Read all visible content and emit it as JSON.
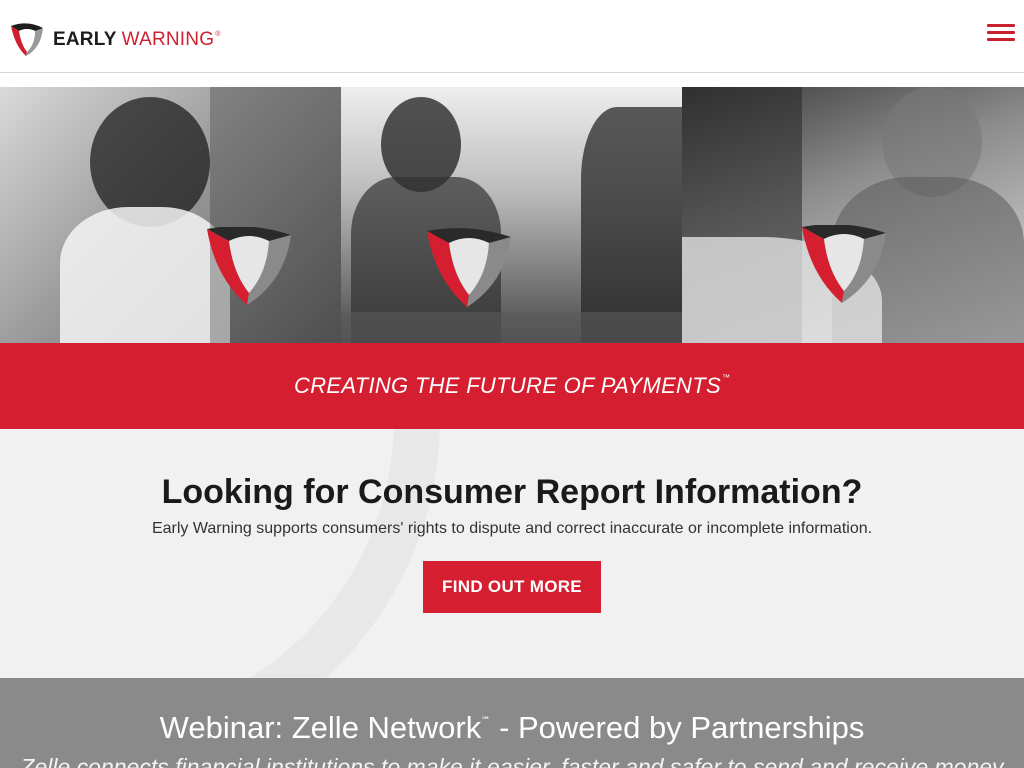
{
  "header": {
    "logo": {
      "early": "EARLY",
      "warning": "WARNING",
      "reg": "®"
    },
    "menu_icon": "hamburger-icon"
  },
  "hero": {
    "panels": [
      {
        "name": "woman-with-phone-photo"
      },
      {
        "name": "handshake-photo"
      },
      {
        "name": "card-payment-photo"
      }
    ],
    "brand_color": "#d51f30"
  },
  "banner": {
    "text": "CREATING THE FUTURE OF PAYMENTS",
    "tm": "™"
  },
  "consumer": {
    "title": "Looking for Consumer Report Information?",
    "text": "Early Warning supports consumers' rights to dispute and correct inaccurate or incomplete information.",
    "button": "FIND OUT MORE"
  },
  "webinar": {
    "title_prefix": "Webinar: Zelle Network",
    "sm": "℠",
    "title_suffix": "- Powered by Partnerships",
    "text": "Zelle connects financial institutions to make it easier, faster and safer to send and receive money"
  }
}
